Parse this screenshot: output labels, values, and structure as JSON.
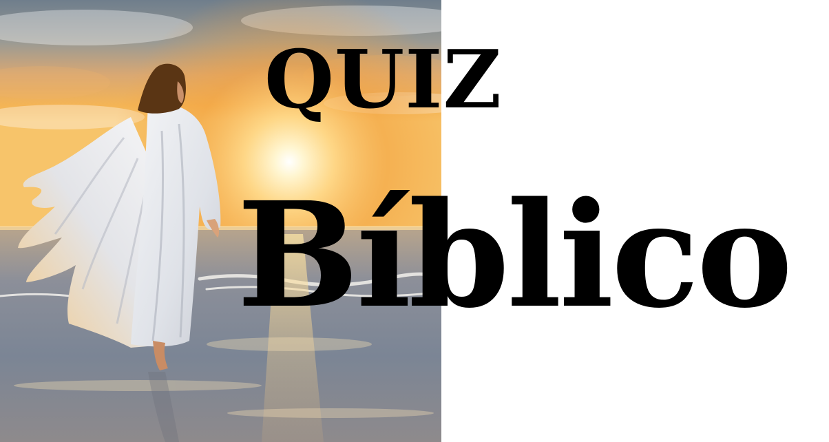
{
  "title": {
    "line1": "QUIZ",
    "line2": "Bíblico"
  },
  "image": {
    "subject": "painting-figure-in-white-robe-walking-on-beach-at-sunset",
    "colors": {
      "sky_top": "#7f8c98",
      "sun_glow": "#fff3c4",
      "sky_warm": "#f2a23c",
      "sea": "#7b8797",
      "sand": "#a89a90",
      "robe": "#eef0f3",
      "hair": "#5a3514"
    }
  },
  "colors": {
    "text": "#000000",
    "background": "#ffffff"
  }
}
